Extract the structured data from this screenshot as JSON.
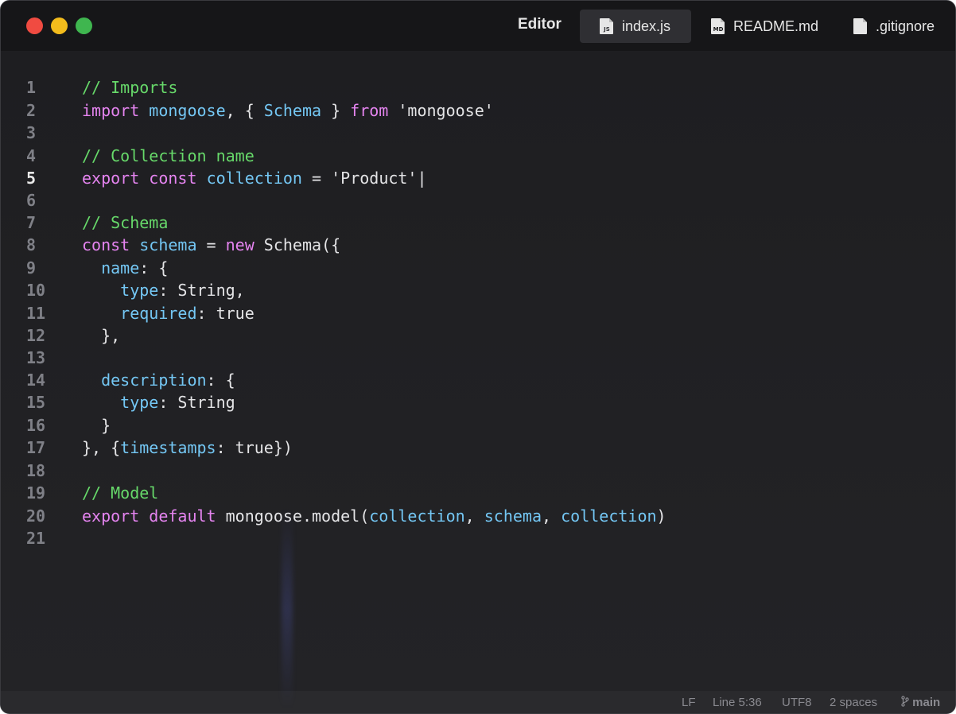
{
  "window": {
    "app_title": "Editor",
    "traffic_lights": [
      "close",
      "minimize",
      "zoom"
    ]
  },
  "tabs": [
    {
      "label": "index.js",
      "icon": "js-file-icon",
      "badge": "JS",
      "active": true
    },
    {
      "label": "README.md",
      "icon": "markdown-file-icon",
      "badge": "MD",
      "active": false
    },
    {
      "label": ".gitignore",
      "icon": "file-icon",
      "badge": "",
      "active": false
    }
  ],
  "editor": {
    "current_line": 5,
    "lines": [
      {
        "num": "1",
        "tokens": [
          {
            "t": "// Imports",
            "c": "c"
          }
        ]
      },
      {
        "num": "2",
        "tokens": [
          {
            "t": "import",
            "c": "k"
          },
          {
            "t": " ",
            "c": "p"
          },
          {
            "t": "mongoose",
            "c": "v"
          },
          {
            "t": ", { ",
            "c": "p"
          },
          {
            "t": "Schema",
            "c": "v"
          },
          {
            "t": " } ",
            "c": "p"
          },
          {
            "t": "from",
            "c": "k"
          },
          {
            "t": " 'mongoose'",
            "c": "s"
          }
        ]
      },
      {
        "num": "3",
        "tokens": []
      },
      {
        "num": "4",
        "tokens": [
          {
            "t": "// Collection name",
            "c": "c"
          }
        ]
      },
      {
        "num": "5",
        "tokens": [
          {
            "t": "export",
            "c": "k"
          },
          {
            "t": " ",
            "c": "p"
          },
          {
            "t": "const",
            "c": "k"
          },
          {
            "t": " ",
            "c": "p"
          },
          {
            "t": "collection",
            "c": "v"
          },
          {
            "t": " = 'Product'|",
            "c": "s"
          }
        ]
      },
      {
        "num": "6",
        "tokens": []
      },
      {
        "num": "7",
        "tokens": [
          {
            "t": "// Schema",
            "c": "c"
          }
        ]
      },
      {
        "num": "8",
        "tokens": [
          {
            "t": "const",
            "c": "k"
          },
          {
            "t": " ",
            "c": "p"
          },
          {
            "t": "schema",
            "c": "v"
          },
          {
            "t": " = ",
            "c": "p"
          },
          {
            "t": "new",
            "c": "k"
          },
          {
            "t": " Schema({",
            "c": "p"
          }
        ]
      },
      {
        "num": "9",
        "tokens": [
          {
            "t": "  ",
            "c": "p"
          },
          {
            "t": "name",
            "c": "v"
          },
          {
            "t": ": {",
            "c": "p"
          }
        ]
      },
      {
        "num": "10",
        "tokens": [
          {
            "t": "    ",
            "c": "p"
          },
          {
            "t": "type",
            "c": "v"
          },
          {
            "t": ": String,",
            "c": "p"
          }
        ]
      },
      {
        "num": "11",
        "tokens": [
          {
            "t": "    ",
            "c": "p"
          },
          {
            "t": "required",
            "c": "v"
          },
          {
            "t": ": true",
            "c": "p"
          }
        ]
      },
      {
        "num": "12",
        "tokens": [
          {
            "t": "  },",
            "c": "p"
          }
        ]
      },
      {
        "num": "13",
        "tokens": []
      },
      {
        "num": "14",
        "tokens": [
          {
            "t": "  ",
            "c": "p"
          },
          {
            "t": "description",
            "c": "v"
          },
          {
            "t": ": {",
            "c": "p"
          }
        ]
      },
      {
        "num": "15",
        "tokens": [
          {
            "t": "    ",
            "c": "p"
          },
          {
            "t": "type",
            "c": "v"
          },
          {
            "t": ": String",
            "c": "p"
          }
        ]
      },
      {
        "num": "16",
        "tokens": [
          {
            "t": "  }",
            "c": "p"
          }
        ]
      },
      {
        "num": "17",
        "tokens": [
          {
            "t": "}, {",
            "c": "p"
          },
          {
            "t": "timestamps",
            "c": "v"
          },
          {
            "t": ": true})",
            "c": "p"
          }
        ]
      },
      {
        "num": "18",
        "tokens": []
      },
      {
        "num": "19",
        "tokens": [
          {
            "t": "// Model",
            "c": "c"
          }
        ]
      },
      {
        "num": "20",
        "tokens": [
          {
            "t": "export",
            "c": "k"
          },
          {
            "t": " ",
            "c": "p"
          },
          {
            "t": "default",
            "c": "k"
          },
          {
            "t": " mongoose.model(",
            "c": "p"
          },
          {
            "t": "collection",
            "c": "v"
          },
          {
            "t": ", ",
            "c": "p"
          },
          {
            "t": "schema",
            "c": "v"
          },
          {
            "t": ", ",
            "c": "p"
          },
          {
            "t": "collection",
            "c": "v"
          },
          {
            "t": ")",
            "c": "p"
          }
        ]
      },
      {
        "num": "21",
        "tokens": []
      }
    ]
  },
  "statusbar": {
    "line_ending": "LF",
    "cursor_position": "Line 5:36",
    "encoding": "UTF8",
    "indentation": "2 spaces",
    "branch": "main",
    "branch_icon": "git-branch-icon"
  },
  "colors": {
    "window_bg": "#1f1f22",
    "titlebar_bg": "#161618",
    "comment": "#67d96a",
    "keyword": "#e584f0",
    "identifier": "#74c7f4",
    "plain": "#e4e4e6",
    "line_number": "#7f8087"
  }
}
